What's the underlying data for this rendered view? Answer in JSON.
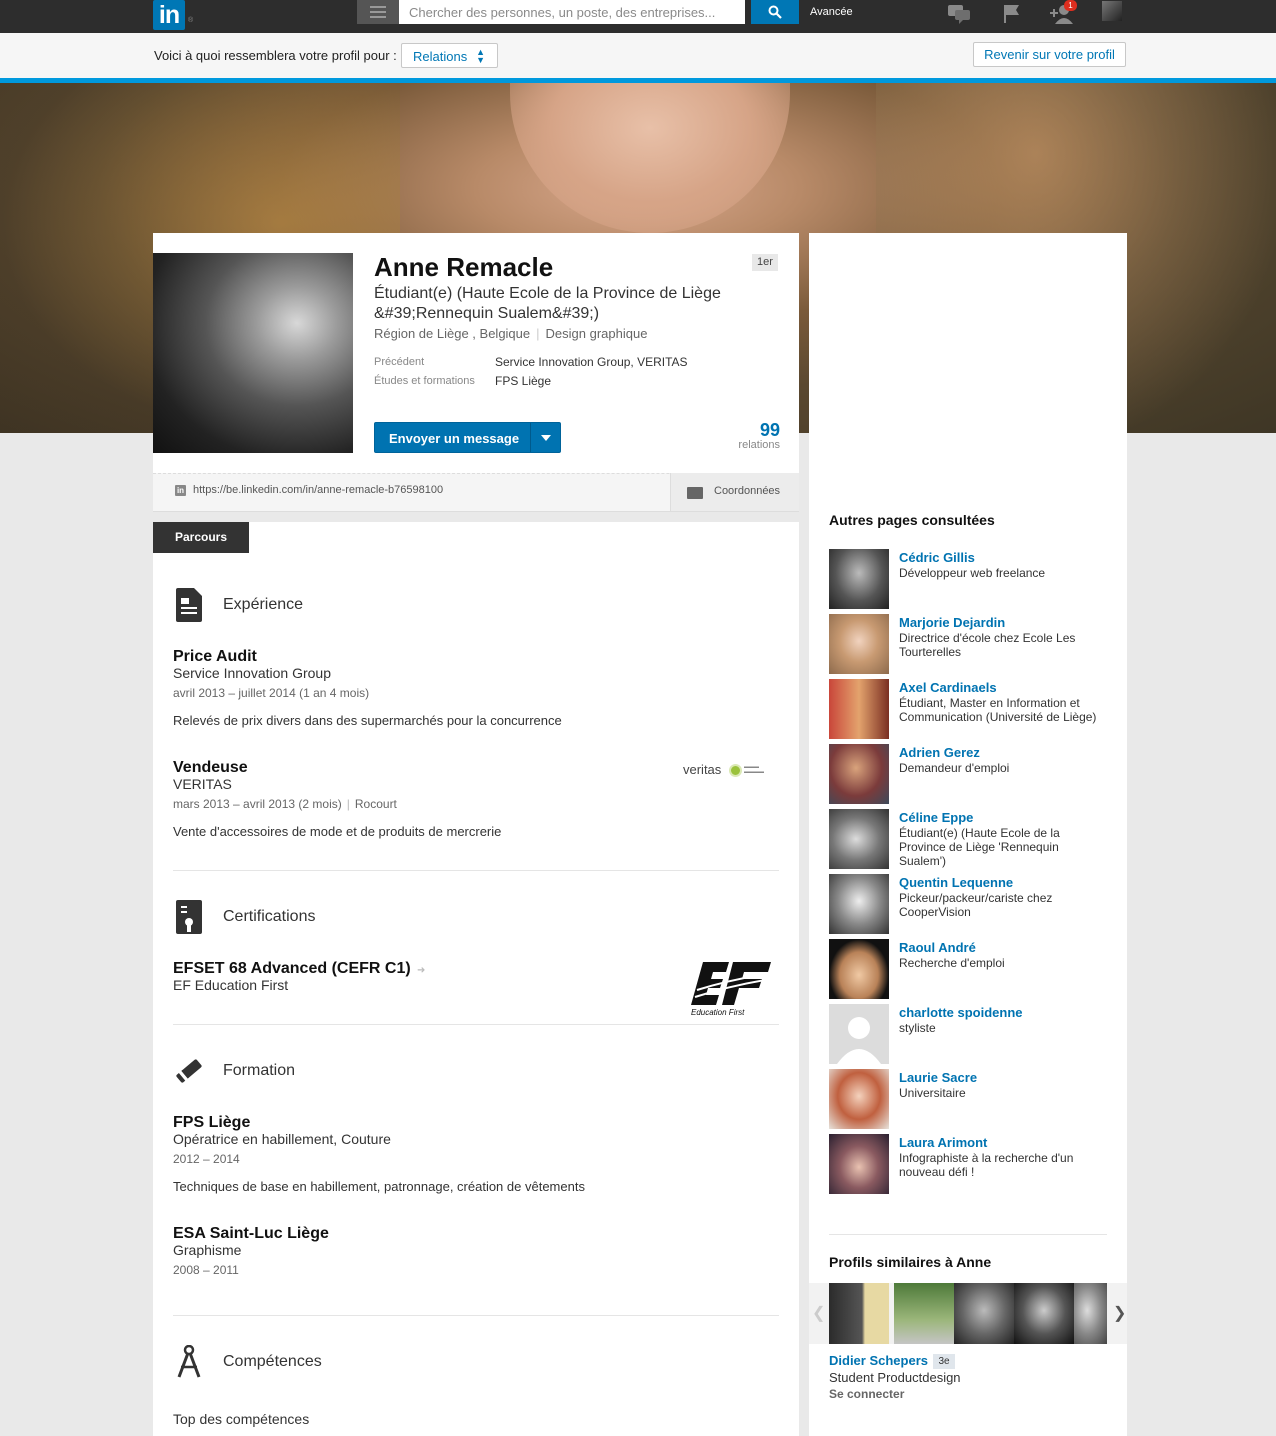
{
  "topbar": {
    "logo_text": "in",
    "logo_tm": "®",
    "search_placeholder": "Chercher des personnes, un poste, des entreprises...",
    "advanced_label": "Avancée",
    "notification_count": "1"
  },
  "preview": {
    "label": "Voici à quoi ressemblera votre profil pour :",
    "audience_value": "Relations",
    "back_button": "Revenir sur votre profil"
  },
  "profile": {
    "name": "Anne Remacle",
    "degree": "1er",
    "headline": "Étudiant(e) (Haute Ecole de la Province de Liège &#39;Rennequin Sualem&#39;)",
    "location": "Région de Liège , Belgique",
    "industry": "Design graphique",
    "previous_label": "Précédent",
    "previous_value": "Service Innovation Group, VERITAS",
    "education_label": "Études et formations",
    "education_value": "FPS Liège",
    "message_button": "Envoyer un message",
    "connections_count": "99",
    "connections_label": "relations",
    "public_url": "https://be.linkedin.com/in/anne-remacle-b76598100",
    "contact_label": "Coordonnées"
  },
  "background": {
    "tab_label": "Parcours",
    "experience": {
      "title": "Expérience",
      "items": [
        {
          "title": "Price Audit",
          "company": "Service Innovation Group",
          "dates": "avril 2013 – juillet 2014 (1 an 4 mois)",
          "location": "",
          "description": "Relevés de prix divers dans des supermarchés pour la concurrence"
        },
        {
          "title": "Vendeuse",
          "company": "VERITAS",
          "dates": "mars 2013 – avril 2013 (2 mois)",
          "location": "Rocourt",
          "description": "Vente d'accessoires de mode et de produits de mercrerie",
          "logo_text": "veritas"
        }
      ]
    },
    "certifications": {
      "title": "Certifications",
      "items": [
        {
          "title": "EFSET 68 Advanced (CEFR C1)",
          "issuer": "EF Education First",
          "logo_caption": "Education First"
        }
      ]
    },
    "education": {
      "title": "Formation",
      "items": [
        {
          "school": "FPS Liège",
          "degree": "Opératrice en habillement, Couture",
          "dates": "2012 – 2014",
          "description": "Techniques de base en habillement, patronnage, création de vêtements"
        },
        {
          "school": "ESA Saint-Luc Liège",
          "degree": "Graphisme",
          "dates": "2008 – 2011",
          "description": ""
        }
      ]
    },
    "skills": {
      "title": "Compétences",
      "top_label": "Top des compétences"
    }
  },
  "sidebar": {
    "also_viewed_title": "Autres pages consultées",
    "also_viewed": [
      {
        "name": "Cédric Gillis",
        "title": "Développeur web freelance"
      },
      {
        "name": "Marjorie Dejardin",
        "title": "Directrice d'école chez Ecole Les Tourterelles"
      },
      {
        "name": "Axel Cardinaels",
        "title": "Étudiant, Master en Information et Communication (Université de Liège)"
      },
      {
        "name": "Adrien Gerez",
        "title": "Demandeur d'emploi"
      },
      {
        "name": "Céline Eppe",
        "title": "Étudiant(e) (Haute Ecole de la Province de Liège 'Rennequin Sualem')"
      },
      {
        "name": "Quentin Lequenne",
        "title": "Pickeur/packeur/cariste chez CooperVision"
      },
      {
        "name": "Raoul André",
        "title": "Recherche d'emploi"
      },
      {
        "name": "charlotte spoidenne",
        "title": "styliste"
      },
      {
        "name": "Laurie Sacre",
        "title": "Universitaire"
      },
      {
        "name": "Laura Arimont",
        "title": "Infographiste à la recherche d'un nouveau défi !"
      }
    ],
    "similar_title": "Profils similaires à Anne",
    "similar": {
      "name": "Didier Schepers",
      "degree": "3e",
      "title": "Student Productdesign",
      "connect_label": "Se connecter"
    }
  },
  "colors": {
    "brand_blue": "#0077b5",
    "link_blue": "#0073b1",
    "topbar_bg": "#2d2d2d",
    "accent_line": "#0099dd",
    "badge_red": "#dd2e1f"
  },
  "icons": [
    "menu-icon",
    "search-icon",
    "messages-icon",
    "flag-icon",
    "add-connection-icon",
    "chevron-down-icon",
    "linkedin-small-icon",
    "folder-icon",
    "document-icon",
    "certificate-icon",
    "diploma-icon",
    "compass-icon",
    "chevron-left-icon",
    "chevron-right-icon",
    "arrow-right-icon"
  ]
}
